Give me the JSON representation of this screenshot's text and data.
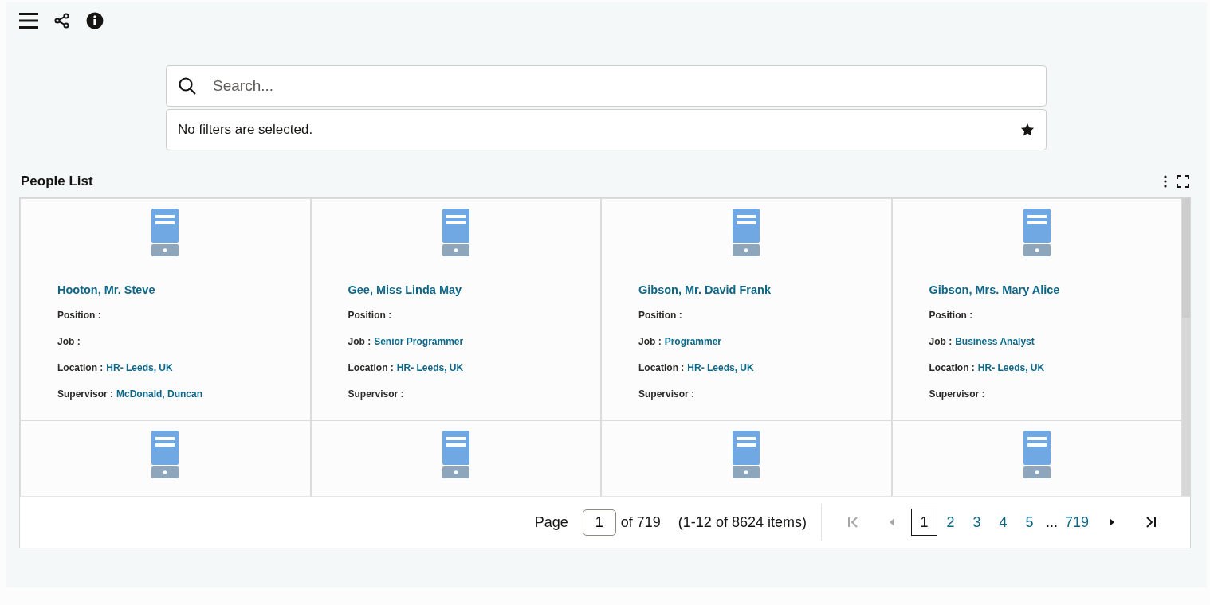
{
  "search": {
    "placeholder": "Search..."
  },
  "filters": {
    "text": "No filters are selected."
  },
  "panel": {
    "title": "People List"
  },
  "cards": [
    {
      "kind": "person",
      "name": "Hooton, Mr. Steve",
      "fields": [
        {
          "label": "Position :"
        },
        {
          "label": "Job :"
        },
        {
          "label": "Location :",
          "value": "HR- Leeds, UK"
        },
        {
          "label": "Supervisor :",
          "value": "McDonald, Duncan"
        }
      ]
    },
    {
      "kind": "person",
      "name": "Gee, Miss Linda May",
      "fields": [
        {
          "label": "Position :"
        },
        {
          "label": "Job :",
          "value": "Senior Programmer"
        },
        {
          "label": "Location :",
          "value": "HR- Leeds, UK"
        },
        {
          "label": "Supervisor :"
        }
      ]
    },
    {
      "kind": "person",
      "name": "Gibson, Mr. David Frank",
      "fields": [
        {
          "label": "Position :"
        },
        {
          "label": "Job :",
          "value": "Programmer"
        },
        {
          "label": "Location :",
          "value": "HR- Leeds, UK"
        },
        {
          "label": "Supervisor :"
        }
      ]
    },
    {
      "kind": "person",
      "name": "Gibson, Mrs. Mary Alice",
      "fields": [
        {
          "label": "Position :"
        },
        {
          "label": "Job :",
          "value": "Business Analyst"
        },
        {
          "label": "Location :",
          "value": "HR- Leeds, UK"
        },
        {
          "label": "Supervisor :"
        }
      ]
    },
    {
      "kind": "icon_only"
    },
    {
      "kind": "icon_only"
    },
    {
      "kind": "icon_only"
    },
    {
      "kind": "icon_only"
    }
  ],
  "pagination": {
    "page_label": "Page",
    "page_value": "1",
    "of_total": "of 719",
    "range": "(1-12 of 8624 items)",
    "first_disabled": true,
    "prev_disabled": true,
    "next_disabled": false,
    "last_disabled": false,
    "pages": [
      {
        "kind": "page",
        "label": "1",
        "selected": true
      },
      {
        "kind": "page",
        "label": "2",
        "selected": false
      },
      {
        "kind": "page",
        "label": "3",
        "selected": false
      },
      {
        "kind": "page",
        "label": "4",
        "selected": false
      },
      {
        "kind": "page",
        "label": "5",
        "selected": false
      },
      {
        "kind": "ellipsis",
        "label": "..."
      },
      {
        "kind": "page",
        "label": "719",
        "selected": false
      }
    ]
  }
}
